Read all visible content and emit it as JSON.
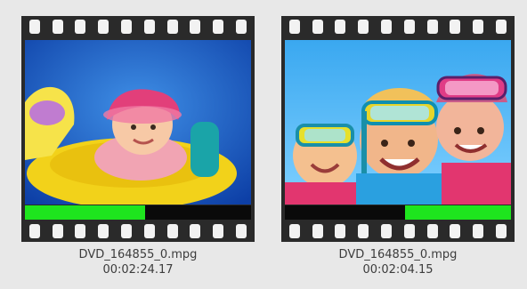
{
  "clips": [
    {
      "filename": "DVD_164855_0.mpg",
      "duration": "00:02:24.17",
      "progress_percent": 53,
      "progress_align": "left",
      "thumbnail_icon": "baby-in-pool-float-thumbnail"
    },
    {
      "filename": "DVD_164855_0.mpg",
      "duration": "00:02:04.15",
      "progress_percent": 47,
      "progress_align": "right",
      "thumbnail_icon": "kids-with-snorkel-masks-thumbnail"
    }
  ],
  "colors": {
    "progress_fill": "#1ee51e",
    "progress_track": "#0a0a0a",
    "film_strip": "#2a2a2a",
    "background": "#e8e8e8"
  }
}
